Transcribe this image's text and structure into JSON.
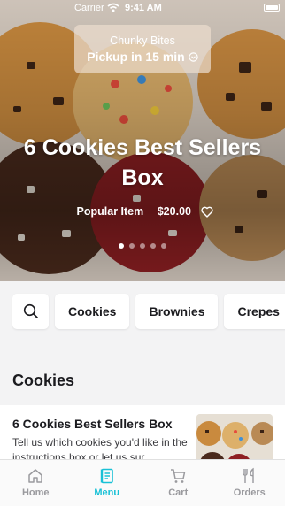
{
  "status_bar": {
    "carrier": "Carrier",
    "time": "9:41 AM"
  },
  "pickup": {
    "store_name": "Chunky Bites",
    "eta": "Pickup in 15 min"
  },
  "hero": {
    "title": "6 Cookies Best Sellers Box",
    "tag": "Popular Item",
    "price": "$20.00",
    "carousel": {
      "pages": 5,
      "active_index": 0
    }
  },
  "categories": [
    "Cookies",
    "Brownies",
    "Crepes"
  ],
  "section": {
    "title": "Cookies"
  },
  "items": [
    {
      "name": "6 Cookies Best Sellers Box",
      "description": "Tell us which cookies you'd like in the instructions box or let us sur..."
    }
  ],
  "tabs": [
    {
      "label": "Home",
      "icon": "home-icon"
    },
    {
      "label": "Menu",
      "icon": "menu-book-icon",
      "active": true
    },
    {
      "label": "Cart",
      "icon": "cart-icon"
    },
    {
      "label": "Orders",
      "icon": "cutlery-icon"
    }
  ],
  "colors": {
    "accent": "#19c1d6",
    "inactive": "#9a9a9e"
  }
}
